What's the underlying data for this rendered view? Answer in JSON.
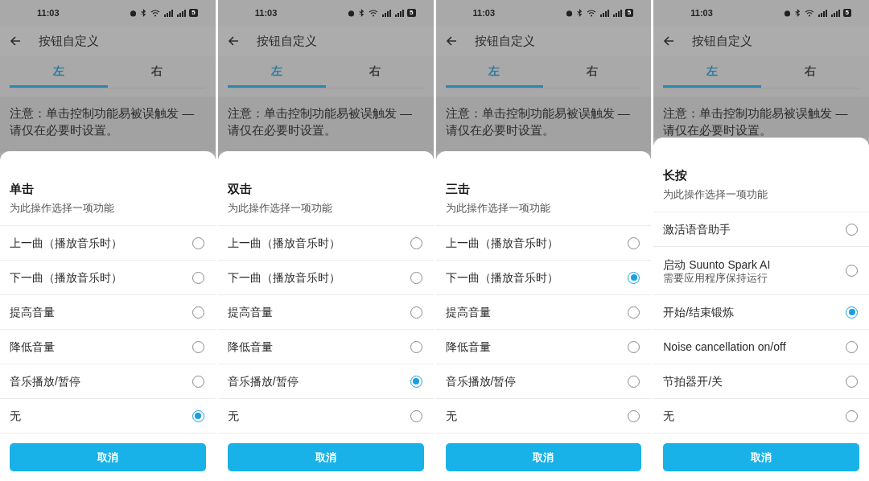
{
  "panels": [
    {
      "status": {
        "time": "11:03",
        "battery": "5"
      },
      "title": "按钮自定义",
      "tabs": [
        {
          "label": "左",
          "selected": true
        },
        {
          "label": "右",
          "selected": false
        }
      ],
      "notice": "注意：单击控制功能易被误触发 — 请仅在必要时设置。",
      "sheet": {
        "title": "单击",
        "subtitle": "为此操作选择一项功能",
        "options": [
          {
            "label": "上一曲（播放音乐时）",
            "selected": false
          },
          {
            "label": "下一曲（播放音乐时）",
            "selected": false
          },
          {
            "label": "提高音量",
            "selected": false
          },
          {
            "label": "降低音量",
            "selected": false
          },
          {
            "label": "音乐播放/暂停",
            "selected": false
          },
          {
            "label": "无",
            "selected": true
          }
        ],
        "cancel": "取消"
      }
    },
    {
      "status": {
        "time": "11:03",
        "battery": "5"
      },
      "title": "按钮自定义",
      "tabs": [
        {
          "label": "左",
          "selected": true
        },
        {
          "label": "右",
          "selected": false
        }
      ],
      "notice": "注意：单击控制功能易被误触发 — 请仅在必要时设置。",
      "sheet": {
        "title": "双击",
        "subtitle": "为此操作选择一项功能",
        "options": [
          {
            "label": "上一曲（播放音乐时）",
            "selected": false
          },
          {
            "label": "下一曲（播放音乐时）",
            "selected": false
          },
          {
            "label": "提高音量",
            "selected": false
          },
          {
            "label": "降低音量",
            "selected": false
          },
          {
            "label": "音乐播放/暂停",
            "selected": true
          },
          {
            "label": "无",
            "selected": false
          }
        ],
        "cancel": "取消"
      }
    },
    {
      "status": {
        "time": "11:03",
        "battery": "5"
      },
      "title": "按钮自定义",
      "tabs": [
        {
          "label": "左",
          "selected": true
        },
        {
          "label": "右",
          "selected": false
        }
      ],
      "notice": "注意：单击控制功能易被误触发 — 请仅在必要时设置。",
      "sheet": {
        "title": "三击",
        "subtitle": "为此操作选择一项功能",
        "options": [
          {
            "label": "上一曲（播放音乐时）",
            "selected": false
          },
          {
            "label": "下一曲（播放音乐时）",
            "selected": true
          },
          {
            "label": "提高音量",
            "selected": false
          },
          {
            "label": "降低音量",
            "selected": false
          },
          {
            "label": "音乐播放/暂停",
            "selected": false
          },
          {
            "label": "无",
            "selected": false
          }
        ],
        "cancel": "取消"
      }
    },
    {
      "status": {
        "time": "11:03",
        "battery": "5"
      },
      "title": "按钮自定义",
      "tabs": [
        {
          "label": "左",
          "selected": true
        },
        {
          "label": "右",
          "selected": false
        }
      ],
      "notice": "注意：单击控制功能易被误触发 — 请仅在必要时设置。",
      "sheet": {
        "title": "长按",
        "subtitle": "为此操作选择一项功能",
        "options": [
          {
            "label": "激活语音助手",
            "selected": false
          },
          {
            "label": "启动 Suunto Spark AI",
            "sublabel": "需要应用程序保持运行",
            "selected": false
          },
          {
            "label": "开始/结束锻炼",
            "selected": true
          },
          {
            "label": "Noise cancellation on/off",
            "selected": false
          },
          {
            "label": "节拍器开/关",
            "selected": false
          },
          {
            "label": "无",
            "selected": false
          }
        ],
        "cancel": "取消"
      }
    }
  ]
}
